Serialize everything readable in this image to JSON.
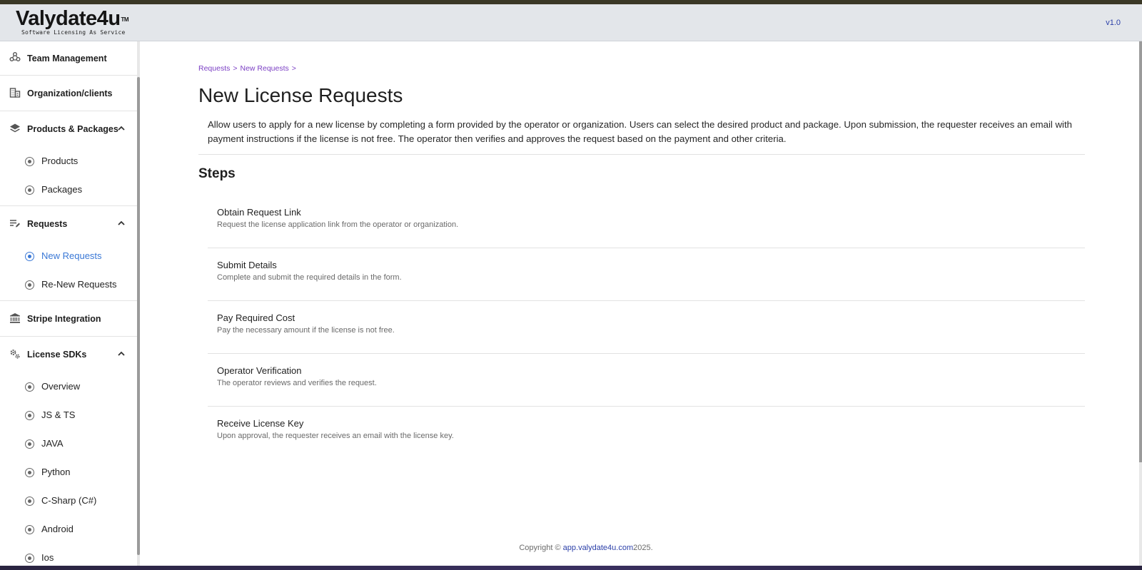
{
  "app": {
    "logo_text": "Valydate4u",
    "logo_tm": "TM",
    "logo_tagline": "Software Licensing As Service",
    "version": "v1.0"
  },
  "sidebar": {
    "team_management": "Team Management",
    "organization_clients": "Organization/clients",
    "products_packages": "Products & Packages",
    "products": "Products",
    "packages": "Packages",
    "requests": "Requests",
    "new_requests": "New Requests",
    "renew_requests": "Re-New Requests",
    "stripe_integration": "Stripe Integration",
    "license_sdks": "License SDKs",
    "overview": "Overview",
    "js_ts": "JS & TS",
    "java": "JAVA",
    "python": "Python",
    "csharp": "C-Sharp (C#)",
    "android": "Android",
    "ios": "Ios"
  },
  "breadcrumb": {
    "item1": "Requests",
    "sep1": ">",
    "item2": "New Requests",
    "sep2": ">"
  },
  "page": {
    "title": "New License Requests",
    "description": "Allow users to apply for a new license by completing a form provided by the operator or organization. Users can select the desired product and package. Upon submission, the requester receives an email with payment instructions if the license is not free. The operator then verifies and approves the request based on the payment and other criteria.",
    "steps_heading": "Steps"
  },
  "steps": [
    {
      "title": "Obtain Request Link",
      "desc": "Request the license application link from the operator or organization."
    },
    {
      "title": "Submit Details",
      "desc": "Complete and submit the required details in the form."
    },
    {
      "title": "Pay Required Cost",
      "desc": "Pay the necessary amount if the license is not free."
    },
    {
      "title": "Operator Verification",
      "desc": "The operator reviews and verifies the request."
    },
    {
      "title": "Receive License Key",
      "desc": "Upon approval, the requester receives an email with the license key."
    }
  ],
  "footer": {
    "prefix": "Copyright ©",
    "link": "app.valydate4u.com",
    "suffix": "2025."
  },
  "colors": {
    "accent": "#3a78d6",
    "breadcrumb": "#7b3fc4",
    "link": "#2b3fa8"
  }
}
